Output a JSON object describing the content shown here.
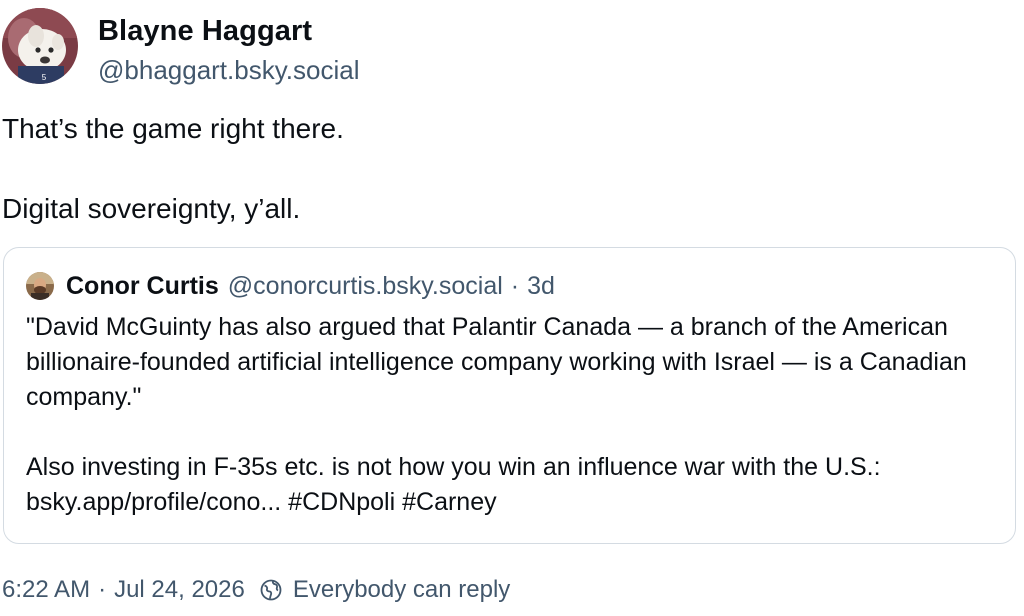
{
  "post": {
    "author": {
      "display_name": "Blayne Haggart",
      "handle": "@bhaggart.bsky.social",
      "avatar_icon": "avatar-photo"
    },
    "paragraphs": [
      "That’s the game right there.",
      "Digital sovereignty, y’all."
    ],
    "quote": {
      "author_name": "Conor Curtis",
      "author_handle": "@conorcurtis.bsky.social",
      "separator": "·",
      "time": "3d",
      "paragraphs": [
        "\"David McGuinty has also argued that Palantir Canada — a branch of the American billionaire-founded artificial intelligence company working with Israel — is a Canadian company.\"",
        "Also investing in F-35s etc. is not how you win an influence war with the U.S.: bsky.app/profile/cono... #CDNpoli #Carney"
      ]
    },
    "footer": {
      "time": "6:22 AM",
      "separator": "·",
      "date": "Jul 24, 2026",
      "reply_setting": "Everybody can reply",
      "reply_icon": "globe-icon"
    }
  },
  "colors": {
    "text": "#0b0f14",
    "muted": "#42576c",
    "border": "#d4dbe2"
  }
}
